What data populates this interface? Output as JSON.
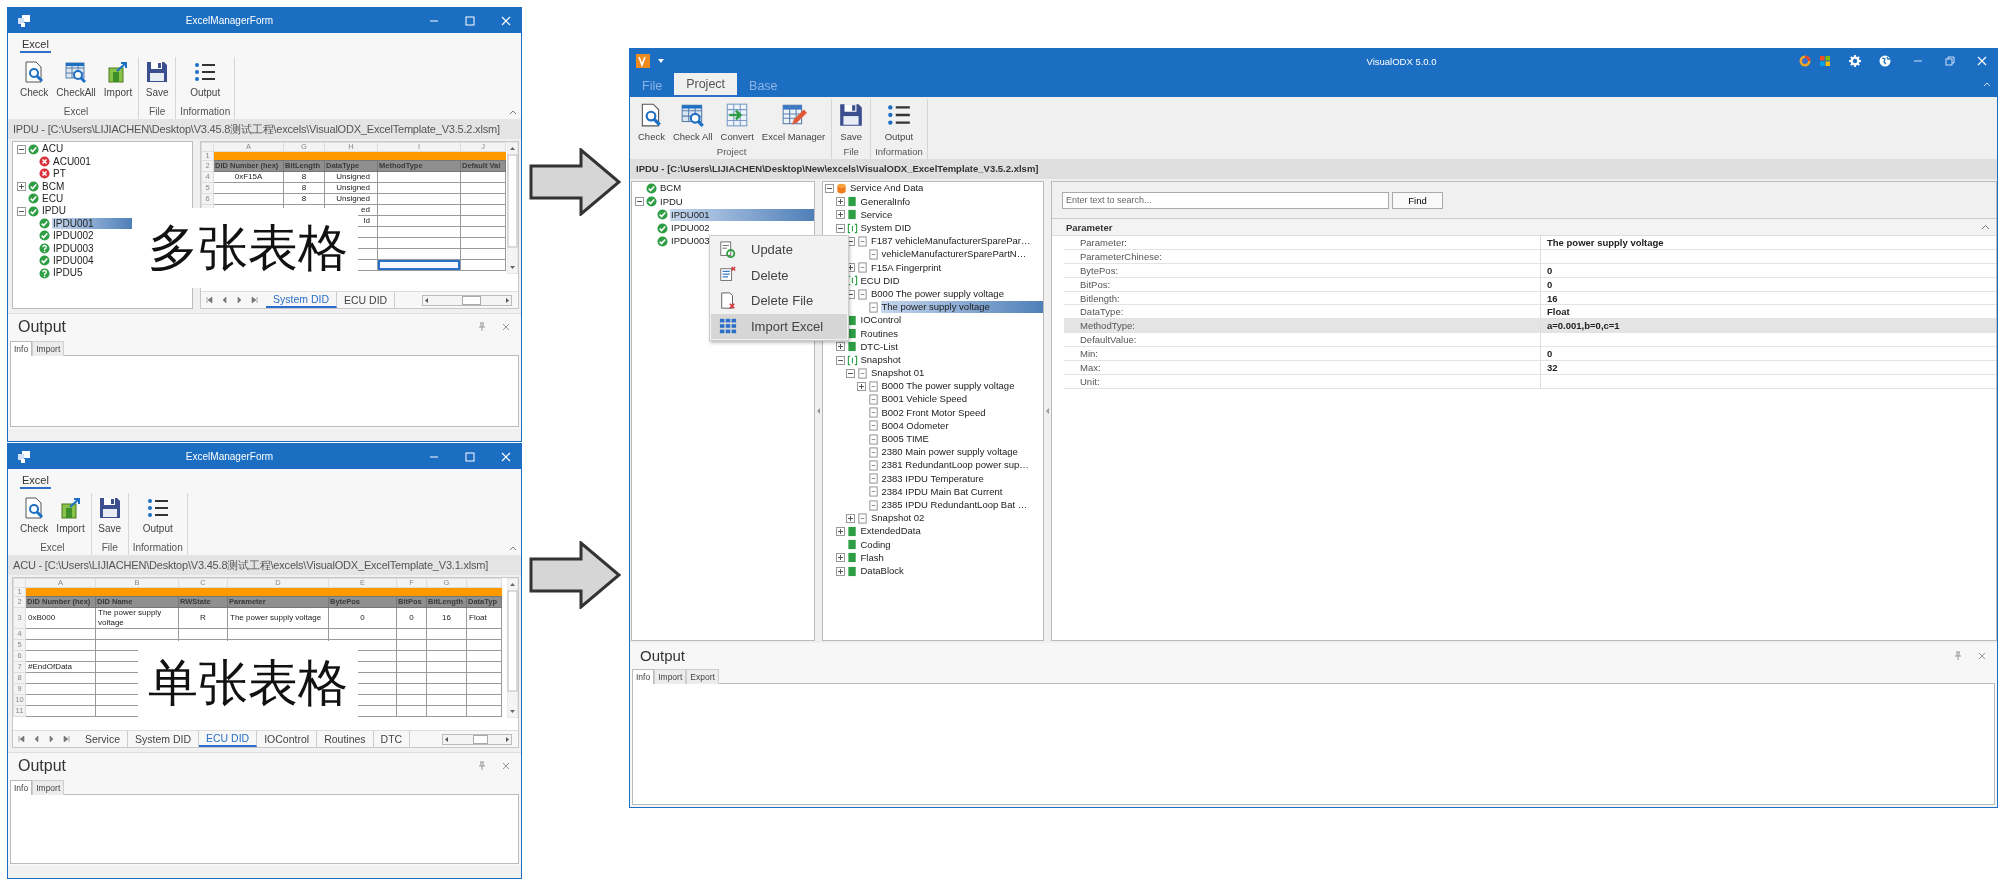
{
  "excel_windows": [
    {
      "title": "ExcelManagerForm",
      "ribbon_tabs": [
        {
          "label": "Excel",
          "selected": true
        }
      ],
      "ribbon_groups": [
        {
          "label": "Excel",
          "buttons": [
            {
              "label": "Check",
              "kind": "check"
            },
            {
              "label": "CheckAll",
              "kind": "check_all"
            },
            {
              "label": "Import",
              "kind": "import"
            }
          ]
        },
        {
          "label": "File",
          "buttons": [
            {
              "label": "Save",
              "kind": "save"
            }
          ]
        },
        {
          "label": "Information",
          "buttons": [
            {
              "label": "Output",
              "kind": "output"
            }
          ]
        }
      ],
      "path": "IPDU - [C:\\Users\\LIJIACHEN\\Desktop\\V3.45.8测试工程\\excels\\VisualODX_ExcelTemplate_V3.5.2.xlsm]",
      "tree": [
        {
          "label": "ACU",
          "kind": "ok",
          "expanded": true,
          "selected": false,
          "children": [
            {
              "label": "ACU001",
              "kind": "error",
              "selected": false
            },
            {
              "label": "PT",
              "kind": "error",
              "selected": false
            }
          ]
        },
        {
          "label": "BCM",
          "kind": "ok",
          "expanded": false,
          "selected": false
        },
        {
          "label": "ECU",
          "kind": "ok",
          "selected": false
        },
        {
          "label": "IPDU",
          "kind": "ok",
          "expanded": true,
          "selected": false,
          "children": [
            {
              "label": "IPDU001",
              "kind": "ok",
              "selected": true
            },
            {
              "label": "IPDU002",
              "kind": "ok",
              "selected": false
            },
            {
              "label": "IPDU003",
              "kind": "unknown",
              "selected": false
            },
            {
              "label": "IPDU004",
              "kind": "ok",
              "selected": false
            },
            {
              "label": "IPDU5",
              "kind": "unknown",
              "selected": false
            }
          ]
        }
      ],
      "sheet": {
        "columns": [
          "A",
          "G",
          "H",
          "I",
          "J"
        ],
        "rows": [
          {
            "kind": "band",
            "number": "1"
          },
          {
            "kind": "header",
            "number": "2",
            "cells": [
              "DID Number (hex)",
              "BitLength",
              "DataType",
              "MethodType",
              "Default Val"
            ]
          },
          {
            "kind": "data",
            "number": "4",
            "cells": [
              "0xF15A",
              "8",
              "Unsigned"
            ]
          },
          {
            "kind": "data",
            "number": "5",
            "cells": [
              "",
              "8",
              "Unsigned"
            ]
          },
          {
            "kind": "data",
            "number": "6",
            "cells": [
              "",
              "8",
              "Unsigned"
            ]
          },
          {
            "kind": "data",
            "cells": [
              "",
              "",
              "ed"
            ]
          },
          {
            "kind": "data",
            "cells": [
              "",
              "",
              "ld"
            ]
          },
          {
            "kind": "data"
          },
          {
            "kind": "data"
          },
          {
            "kind": "data"
          },
          {
            "kind": "data",
            "cells": [
              "",
              "",
              "",
              {
                "selected": true
              },
              {
                "selected": false
              }
            ]
          }
        ]
      },
      "sheet_tabs": [
        {
          "label": "System DID",
          "selected": true
        },
        {
          "label": "ECU DID",
          "selected": false
        }
      ],
      "output": {
        "title": "Output",
        "tabs": [
          {
            "label": "Info",
            "selected": true
          },
          {
            "label": "Import",
            "selected": false
          }
        ]
      },
      "caption": "多张表格"
    },
    {
      "title": "ExcelManagerForm",
      "ribbon_tabs": [
        {
          "label": "Excel",
          "selected": true
        }
      ],
      "ribbon_groups": [
        {
          "label": "Excel",
          "buttons": [
            {
              "label": "Check",
              "kind": "check"
            },
            {
              "label": "Import",
              "kind": "import"
            }
          ]
        },
        {
          "label": "File",
          "buttons": [
            {
              "label": "Save",
              "kind": "save"
            }
          ]
        },
        {
          "label": "Information",
          "buttons": [
            {
              "label": "Output",
              "kind": "output"
            }
          ]
        }
      ],
      "path": "ACU - [C:\\Users\\LIJIACHEN\\Desktop\\V3.45.8测试工程\\excels\\VisualODX_ExcelTemplate_V3.1.xlsm]",
      "sheet": {
        "columns": [
          "A",
          "B",
          "C",
          "D",
          "E",
          "F",
          "G"
        ],
        "rows": [
          {
            "kind": "band",
            "number": "1"
          },
          {
            "kind": "header",
            "number": "2",
            "cells": [
              "DID Number (hex)",
              "DID Name",
              "RWState",
              "Parameter",
              "BytePos",
              "BitPos",
              "BitLength",
              "DataTyp"
            ]
          },
          {
            "kind": "data",
            "number": "3",
            "cells": [
              "0xB000",
              "The power supply voltage",
              "R",
              "The power supply voltage",
              "0",
              "0",
              "16",
              "Float"
            ]
          },
          {
            "kind": "data",
            "number": "4"
          },
          {
            "kind": "data",
            "number": "5"
          },
          {
            "kind": "data",
            "number": "6"
          },
          {
            "kind": "data",
            "number": "7",
            "cells": [
              "#EndOfData"
            ]
          },
          {
            "kind": "data",
            "number": "8"
          },
          {
            "kind": "data",
            "number": "9"
          },
          {
            "kind": "data",
            "number": "10"
          },
          {
            "kind": "data",
            "number": "11"
          }
        ]
      },
      "sheet_tabs": [
        {
          "label": "Service",
          "selected": false
        },
        {
          "label": "System DID",
          "selected": false
        },
        {
          "label": "ECU DID",
          "selected": true
        },
        {
          "label": "IOControl",
          "selected": false
        },
        {
          "label": "Routines",
          "selected": false
        },
        {
          "label": "DTC",
          "selected": false
        }
      ],
      "output": {
        "title": "Output",
        "tabs": [
          {
            "label": "Info",
            "selected": true
          },
          {
            "label": "Import",
            "selected": false
          }
        ]
      },
      "caption": "单张表格"
    }
  ],
  "main_window": {
    "title": "VisualODX 5.0.0",
    "tabs": [
      {
        "label": "File",
        "selected": false
      },
      {
        "label": "Project",
        "selected": true
      },
      {
        "label": "Base",
        "selected": false
      }
    ],
    "ribbon_groups": [
      {
        "label": "Project",
        "buttons": [
          {
            "label": "Check",
            "kind": "check"
          },
          {
            "label": "Check All",
            "kind": "check_all"
          },
          {
            "label": "Convert",
            "kind": "convert"
          },
          {
            "label": "Excel Manager",
            "kind": "excel_manager"
          }
        ]
      },
      {
        "label": "File",
        "buttons": [
          {
            "label": "Save",
            "kind": "save"
          }
        ]
      },
      {
        "label": "Information",
        "buttons": [
          {
            "label": "Output",
            "kind": "output"
          }
        ]
      }
    ],
    "path": "IPDU - [C:\\Users\\LIJIACHEN\\Desktop\\New\\excels\\VisualODX_ExcelTemplate_V3.5.2.xlsm]",
    "ecu_tree": [
      {
        "label": "BCM",
        "kind": "ok",
        "selected": false
      },
      {
        "label": "IPDU",
        "kind": "ok",
        "expanded": true,
        "selected": false,
        "children": [
          {
            "label": "IPDU001",
            "kind": "ok",
            "selected": true
          },
          {
            "label": "IPDU002",
            "kind": "ok",
            "selected": false
          },
          {
            "label": "IPDU003",
            "kind": "ok",
            "selected": false
          }
        ]
      }
    ],
    "context_menu": [
      {
        "label": "Update",
        "kind": "update",
        "selected": false
      },
      {
        "label": "Delete",
        "kind": "delete",
        "selected": false
      },
      {
        "label": "Delete File",
        "kind": "delete_file",
        "selected": false
      },
      {
        "label": "Import Excel",
        "kind": "import_excel",
        "selected": true
      }
    ],
    "data_tree": [
      {
        "label": "Service And Data",
        "kind": "database",
        "expanded": true,
        "selected": false,
        "children": [
          {
            "label": "GeneralInfo",
            "kind": "folder",
            "expanded": false,
            "selected": false
          },
          {
            "label": "Service",
            "kind": "folder",
            "expanded": false,
            "selected": false
          },
          {
            "label": "System DID",
            "kind": "group",
            "expanded": true,
            "selected": false,
            "children": [
              {
                "label": "F187 vehicleManufacturerSparePar…",
                "kind": "item",
                "expanded": true,
                "selected": false,
                "children": [
                  {
                    "label": "vehicleManufacturerSparePartN…",
                    "kind": "item",
                    "selected": false
                  }
                ]
              },
              {
                "label": "F15A Fingerprint",
                "kind": "item",
                "expanded": false,
                "selected": false
              }
            ]
          },
          {
            "label": "ECU DID",
            "kind": "group",
            "selected": false,
            "children": [
              {
                "label": "B000 The power supply voltage",
                "kind": "item",
                "expanded": true,
                "selected": false,
                "children": [
                  {
                    "label": "The power supply voltage",
                    "kind": "item",
                    "selected": true
                  }
                ]
              }
            ]
          },
          {
            "label": "IOControl",
            "kind": "folder",
            "selected": false
          },
          {
            "label": "Routines",
            "kind": "folder",
            "selected": false
          },
          {
            "label": "DTC-List",
            "kind": "folder",
            "expanded": false,
            "selected": false
          },
          {
            "label": "Snapshot",
            "kind": "group",
            "expanded": true,
            "selected": false,
            "children": [
              {
                "label": "Snapshot 01",
                "kind": "item",
                "expanded": true,
                "selected": false,
                "children": [
                  {
                    "label": "B000 The power supply voltage",
                    "kind": "item",
                    "expanded": false,
                    "selected": false
                  },
                  {
                    "label": "B001 Vehicle Speed",
                    "kind": "item",
                    "selected": false
                  },
                  {
                    "label": "B002 Front Motor Speed",
                    "kind": "item",
                    "selected": false
                  },
                  {
                    "label": "B004 Odometer",
                    "kind": "item",
                    "selected": false
                  },
                  {
                    "label": "B005 TIME",
                    "kind": "item",
                    "selected": false
                  },
                  {
                    "label": "2380 Main power supply voltage",
                    "kind": "item",
                    "selected": false
                  },
                  {
                    "label": "2381 RedundantLoop power sup…",
                    "kind": "item",
                    "selected": false
                  },
                  {
                    "label": "2383 IPDU Temperature",
                    "kind": "item",
                    "selected": false
                  },
                  {
                    "label": "2384 IPDU Main Bat  Current",
                    "kind": "item",
                    "selected": false
                  },
                  {
                    "label": "2385 IPDU RedundantLoop Bat …",
                    "kind": "item",
                    "selected": false
                  }
                ]
              },
              {
                "label": "Snapshot 02",
                "kind": "item",
                "expanded": false,
                "selected": false
              }
            ]
          },
          {
            "label": "ExtendedData",
            "kind": "folder",
            "expanded": false,
            "selected": false
          },
          {
            "label": "Coding",
            "kind": "folder",
            "selected": false
          },
          {
            "label": "Flash",
            "kind": "folder",
            "expanded": false,
            "selected": false
          },
          {
            "label": "DataBlock",
            "kind": "folder",
            "expanded": false,
            "selected": false
          }
        ]
      }
    ],
    "search": {
      "placeholder": "Enter text to search..."
    },
    "find_button": "Find",
    "properties": {
      "category": "Parameter",
      "expanded": true,
      "rows": [
        {
          "label": "Parameter:",
          "value": "The power supply voltage",
          "selected": false
        },
        {
          "label": "ParameterChinese:",
          "selected": false
        },
        {
          "label": "BytePos:",
          "value": "0",
          "selected": false
        },
        {
          "label": "BitPos:",
          "value": "0",
          "selected": false
        },
        {
          "label": "Bitlength:",
          "value": "16",
          "selected": false
        },
        {
          "label": "DataType:",
          "value": "Float",
          "selected": false
        },
        {
          "label": "MethodType:",
          "value": "a=0.001,b=0,c=1",
          "selected": true
        },
        {
          "label": "DefaultValue:",
          "selected": false
        },
        {
          "label": "Min:",
          "value": "0",
          "selected": false
        },
        {
          "label": "Max:",
          "value": "32",
          "selected": false
        },
        {
          "label": "Unit:",
          "selected": false
        }
      ]
    },
    "output": {
      "title": "Output",
      "tabs": [
        {
          "label": "Info",
          "selected": true
        },
        {
          "label": "Import",
          "selected": false
        },
        {
          "label": "Export",
          "selected": false
        }
      ]
    }
  }
}
